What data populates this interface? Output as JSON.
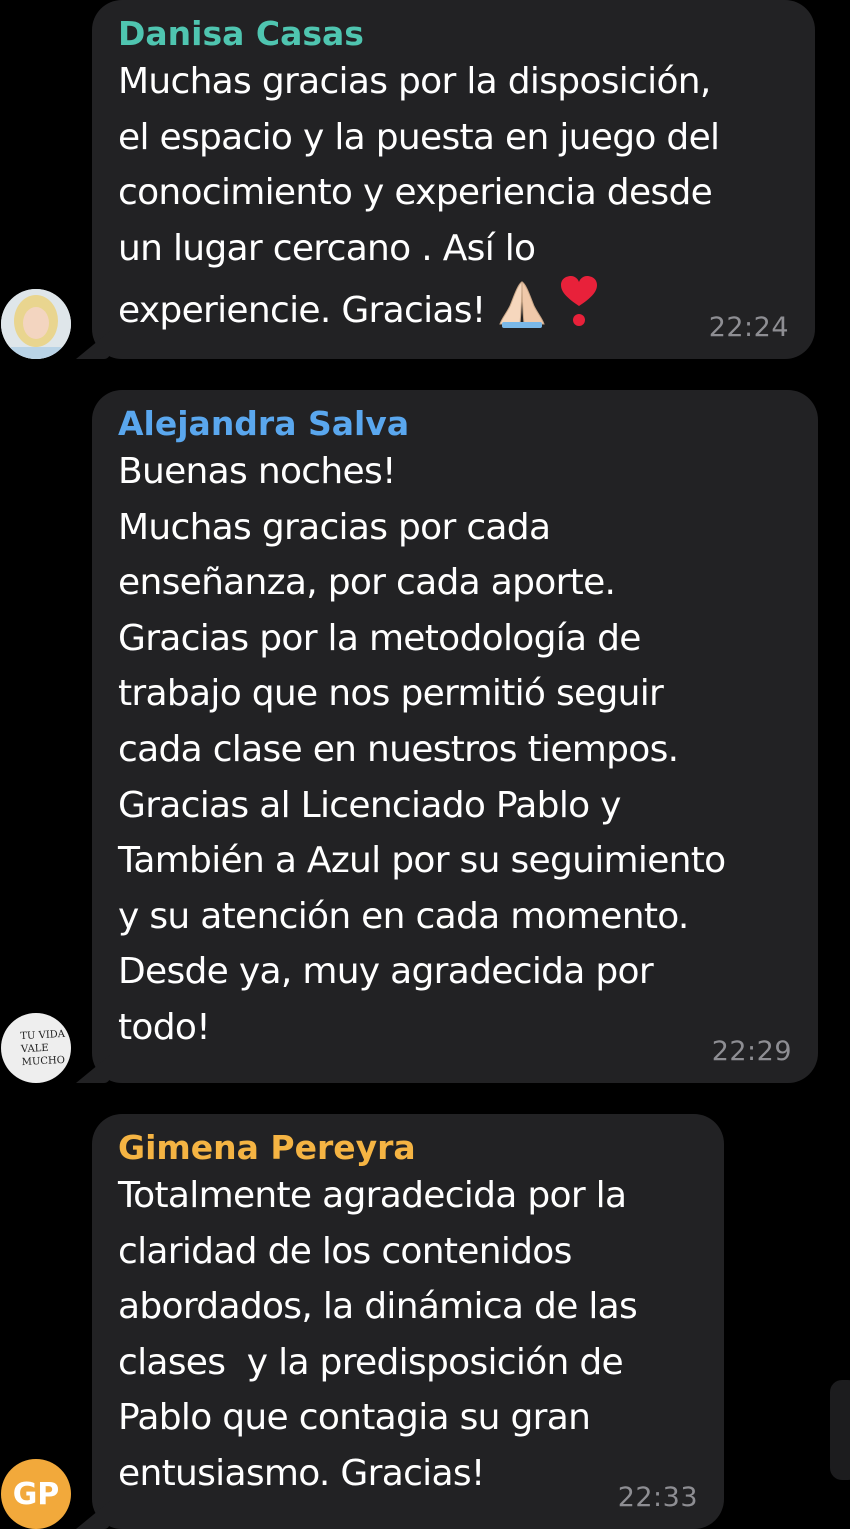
{
  "colors": {
    "background": "#000000",
    "bubble": "#222224",
    "text": "#ffffff",
    "timestamp": "#8e8e93"
  },
  "messages": [
    {
      "sender": "Danisa Casas",
      "sender_color": "#4fc5b0",
      "lines": [
        "Muchas gracias por la disposición,",
        "el espacio y la puesta en juego del",
        "conocimiento y experiencia desde",
        "un lugar cercano . Así lo",
        "experiencie. Gracias!"
      ],
      "emojis": [
        "folded-hands-emoji",
        "heart-exclamation-emoji"
      ],
      "time": "22:24",
      "avatar": "photo-avatar"
    },
    {
      "sender": "Alejandra Salva",
      "sender_color": "#5aa7ee",
      "lines": [
        "Buenas noches!",
        "Muchas gracias por cada",
        "enseñanza, por cada aporte.",
        "Gracias por la metodología de",
        "trabajo que nos permitió seguir",
        "cada clase en nuestros tiempos.",
        "Gracias al Licenciado Pablo y",
        "También a Azul por su seguimiento",
        "y su atención en cada momento.",
        "Desde ya, muy agradecida por",
        "todo!"
      ],
      "time": "22:29",
      "avatar_text": [
        "TU VIDA",
        "VALE",
        "MUCHO"
      ]
    },
    {
      "sender": "Gimena Pereyra",
      "sender_color": "#f5b443",
      "lines": [
        "Totalmente agradecida por la",
        "claridad de los contenidos",
        "abordados, la dinámica de las",
        "clases  y la predisposición de",
        "Pablo que contagia su gran",
        "entusiasmo. Gracias!"
      ],
      "time": "22:33",
      "avatar_initials": "GP",
      "avatar_color": "#f2a93b"
    }
  ]
}
